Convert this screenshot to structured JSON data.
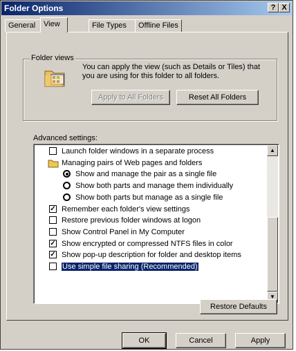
{
  "window": {
    "title": "Folder Options",
    "help_button": "?",
    "close_button": "X"
  },
  "tabs": [
    {
      "label": "General",
      "active": false
    },
    {
      "label": "View",
      "active": true
    },
    {
      "label": "File Types",
      "active": false
    },
    {
      "label": "Offline Files",
      "active": false
    }
  ],
  "folder_views": {
    "group_label": "Folder views",
    "description": "You can apply the view (such as Details or Tiles) that you are using for this folder to all folders.",
    "apply_button": "Apply to All Folders",
    "reset_button": "Reset All Folders",
    "icon": "folder-views-icon"
  },
  "advanced": {
    "label": "Advanced settings:",
    "items": [
      {
        "type": "checkbox",
        "checked": false,
        "label": "Launch folder windows in a separate process"
      },
      {
        "type": "folder",
        "label": "Managing pairs of Web pages and folders"
      },
      {
        "type": "radio",
        "checked": true,
        "label": "Show and manage the pair as a single file"
      },
      {
        "type": "radio",
        "checked": false,
        "label": "Show both parts and manage them individually"
      },
      {
        "type": "radio",
        "checked": false,
        "label": "Show both parts but manage as a single file"
      },
      {
        "type": "checkbox",
        "checked": true,
        "label": "Remember each folder's view settings"
      },
      {
        "type": "checkbox",
        "checked": false,
        "label": "Restore previous folder windows at logon"
      },
      {
        "type": "checkbox",
        "checked": false,
        "label": "Show Control Panel in My Computer"
      },
      {
        "type": "checkbox",
        "checked": true,
        "label": "Show encrypted or compressed NTFS files in color"
      },
      {
        "type": "checkbox",
        "checked": true,
        "label": "Show pop-up description for folder and desktop items"
      },
      {
        "type": "checkbox",
        "checked": false,
        "selected": true,
        "label": "Use simple file sharing (Recommended)"
      }
    ]
  },
  "restore_defaults_button": "Restore Defaults",
  "footer": {
    "ok": "OK",
    "cancel": "Cancel",
    "apply": "Apply"
  },
  "colors": {
    "title_start": "#0a246a",
    "title_end": "#a6caf0",
    "face": "#d4d0c8",
    "selection": "#0a246a"
  }
}
